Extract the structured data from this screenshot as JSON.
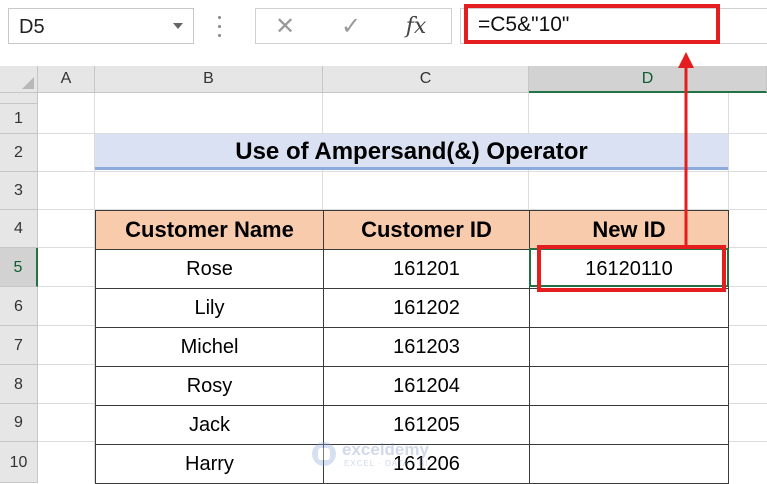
{
  "name_box": {
    "value": "D5"
  },
  "formula_bar": {
    "cancel_icon": "x-icon",
    "enter_icon": "check-icon",
    "insert_function_label": "fx",
    "formula": "=C5&\"10\""
  },
  "columns": [
    "A",
    "B",
    "C",
    "D"
  ],
  "selected_column": "D",
  "rows": [
    "1",
    "2",
    "3",
    "4",
    "5",
    "6",
    "7",
    "8",
    "9",
    "10"
  ],
  "selected_row": "5",
  "sheet": {
    "title": "Use of Ampersand(&) Operator",
    "headers": [
      "Customer Name",
      "Customer ID",
      "New ID"
    ],
    "data": [
      [
        "Rose",
        "161201",
        "16120110"
      ],
      [
        "Lily",
        "161202",
        ""
      ],
      [
        "Michel",
        "161203",
        ""
      ],
      [
        "Rosy",
        "161204",
        ""
      ],
      [
        "Jack",
        "161205",
        ""
      ],
      [
        "Harry",
        "161206",
        ""
      ]
    ]
  },
  "watermark": {
    "text": "exceldemy",
    "sub": "EXCEL · DATA · BI"
  },
  "colors": {
    "highlight": "#e41e1e",
    "header_fill": "#f8cbad",
    "title_fill": "#d9e1f2",
    "selection": "#217346"
  }
}
